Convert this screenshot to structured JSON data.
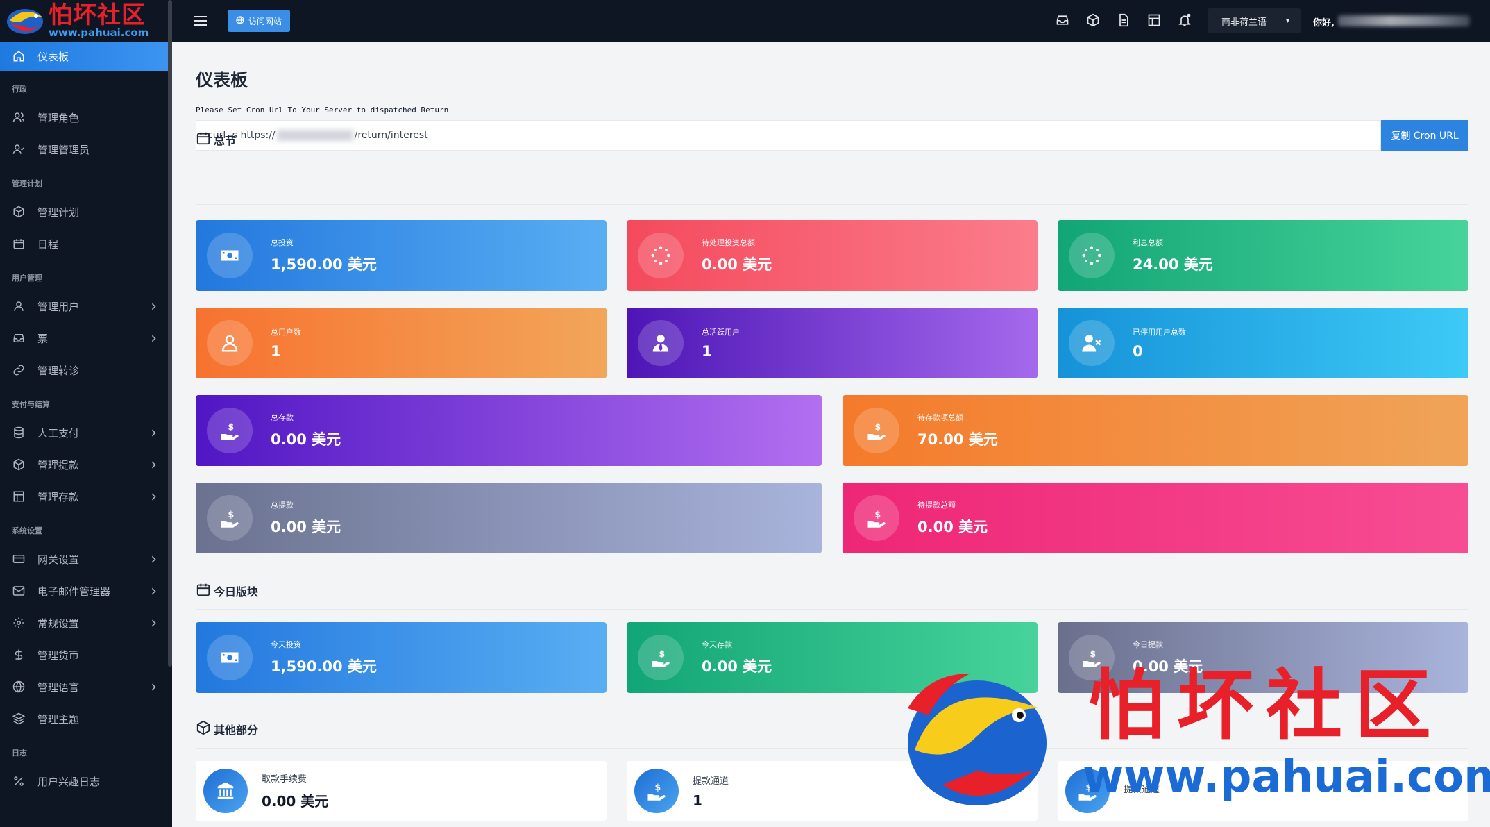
{
  "logo": {
    "cn": "怕坏社区",
    "en": "www.pahuai.com"
  },
  "sidebar": {
    "active": {
      "label": "仪表板",
      "icon": "home-icon"
    },
    "sections": [
      {
        "title": "行政",
        "items": [
          {
            "label": "管理角色",
            "icon": "users-icon",
            "chevron": false
          },
          {
            "label": "管理管理员",
            "icon": "user-check-icon",
            "chevron": false
          }
        ]
      },
      {
        "title": "管理计划",
        "items": [
          {
            "label": "管理计划",
            "icon": "box-icon",
            "chevron": false
          },
          {
            "label": "日程",
            "icon": "calendar-icon",
            "chevron": false
          }
        ]
      },
      {
        "title": "用户管理",
        "items": [
          {
            "label": "管理用户",
            "icon": "user-icon",
            "chevron": true
          },
          {
            "label": "票",
            "icon": "inbox-icon",
            "chevron": true
          },
          {
            "label": "管理转诊",
            "icon": "link-icon",
            "chevron": false
          }
        ]
      },
      {
        "title": "支付与结算",
        "items": [
          {
            "label": "人工支付",
            "icon": "database-icon",
            "chevron": true
          },
          {
            "label": "管理提款",
            "icon": "box-icon",
            "chevron": true
          },
          {
            "label": "管理存款",
            "icon": "layout-icon",
            "chevron": true
          }
        ]
      },
      {
        "title": "系统设置",
        "items": [
          {
            "label": "网关设置",
            "icon": "credit-card-icon",
            "chevron": true
          },
          {
            "label": "电子邮件管理器",
            "icon": "mail-icon",
            "chevron": true
          },
          {
            "label": "常规设置",
            "icon": "settings-icon",
            "chevron": true
          },
          {
            "label": "管理货币",
            "icon": "dollar-icon",
            "chevron": false
          },
          {
            "label": "管理语言",
            "icon": "globe-icon",
            "chevron": true
          },
          {
            "label": "管理主题",
            "icon": "layers-icon",
            "chevron": false
          }
        ]
      },
      {
        "title": "日志",
        "items": [
          {
            "label": "用户兴趣日志",
            "icon": "percent-icon",
            "chevron": false
          }
        ]
      }
    ]
  },
  "topbar": {
    "visit_label": "访问网站",
    "language": "南非荷兰语",
    "greeting": "你好,"
  },
  "main": {
    "title": "仪表板",
    "cron_note": "Please Set Cron Url To Your Server to dispatched Return",
    "cron_prefix": "curl -s https://",
    "cron_suffix": "/return/interest",
    "cron_button": "复制 Cron URL",
    "sections": {
      "summary": "总节",
      "today": "今日版块",
      "other": "其他部分"
    },
    "summary_cards": [
      {
        "label": "总投资",
        "value": "1,590.00 美元",
        "icon": "money-icon"
      },
      {
        "label": "待处理投资总额",
        "value": "0.00 美元",
        "icon": "loader-icon"
      },
      {
        "label": "利息总额",
        "value": "24.00 美元",
        "icon": "loader-icon"
      },
      {
        "label": "总用户数",
        "value": "1",
        "icon": "user-icon"
      },
      {
        "label": "总活跃用户",
        "value": "1",
        "icon": "user-tie-icon"
      },
      {
        "label": "已停用用户总数",
        "value": "0",
        "icon": "user-x-icon"
      },
      {
        "label": "总存款",
        "value": "0.00 美元",
        "icon": "hand-dollar-icon"
      },
      {
        "label": "待存款项总额",
        "value": "70.00 美元",
        "icon": "hand-dollar-icon"
      },
      {
        "label": "总提款",
        "value": "0.00 美元",
        "icon": "hand-dollar-icon"
      },
      {
        "label": "待提款总额",
        "value": "0.00 美元",
        "icon": "hand-dollar-icon"
      }
    ],
    "today_cards": [
      {
        "label": "今天投资",
        "value": "1,590.00 美元",
        "icon": "money-icon"
      },
      {
        "label": "今天存款",
        "value": "0.00 美元",
        "icon": "hand-dollar-icon"
      },
      {
        "label": "今日提款",
        "value": "0.00 美元",
        "icon": "hand-dollar-icon"
      }
    ],
    "other_cards": [
      {
        "label": "取款手续费",
        "value": "0.00 美元",
        "icon": "bank-icon"
      },
      {
        "label": "提款通道",
        "value": "1",
        "icon": "hand-dollar-icon"
      },
      {
        "label": "提款通道",
        "value": "",
        "icon": "hand-dollar-icon"
      }
    ]
  },
  "watermark": {
    "cn": "怕坏社区",
    "en": "www.pahuai.com"
  }
}
